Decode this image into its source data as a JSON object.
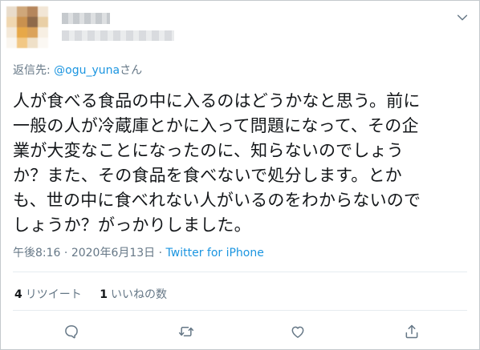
{
  "reply": {
    "prefix": "返信先: ",
    "mention": "@ogu_yuna",
    "suffix": "さん"
  },
  "tweet": {
    "lines": [
      "人が食べる食品の中に入るのはどうかなと思う。前に",
      "一般の人が冷蔵庫とかに入って問題になって、その企",
      "業が大変なことになったのに、知らないのでしょう",
      "か？また、その食品を食べないで処分します。とか",
      "も、世の中に食べれない人がいるのをわからないので",
      "しょうか？がっかりしました。"
    ]
  },
  "meta": {
    "time": "午後8:16",
    "sep1": " · ",
    "date": "2020年6月13日",
    "sep2": " · ",
    "client": "Twitter for iPhone"
  },
  "stats": {
    "retweets_count": "4",
    "retweets_label": "リツイート",
    "likes_count": "1",
    "likes_label": "いいねの数"
  },
  "icons": {
    "caret": "chevron-down-icon",
    "reply": "reply-icon",
    "retweet": "retweet-icon",
    "like": "heart-icon",
    "share": "share-icon"
  },
  "colors": {
    "accent": "#1b95e0",
    "muted": "#657786",
    "text": "#14171a"
  }
}
